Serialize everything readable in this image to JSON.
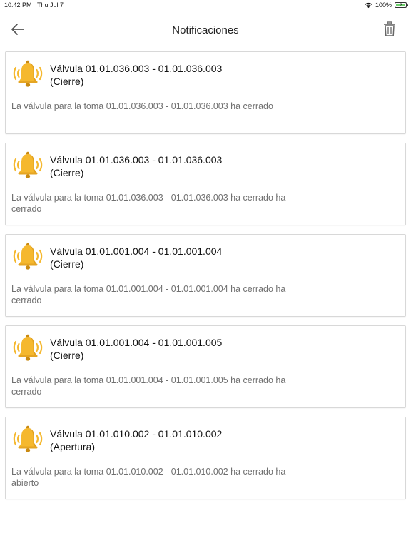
{
  "status": {
    "time": "10:42 PM",
    "date": "Thu Jul 7",
    "battery": "100%"
  },
  "header": {
    "title": "Notificaciones"
  },
  "colors": {
    "bell": "#f5b82e",
    "bell_dark": "#c98a12",
    "text_secondary": "#707070"
  },
  "icons": {
    "back": "arrow-left-icon",
    "trash": "trash-icon",
    "bell": "bell-ringing-icon"
  },
  "notifications": [
    {
      "title": "Válvula 01.01.036.003 - 01.01.036.003",
      "subtitle": "(Cierre)",
      "body": "La válvula para la toma 01.01.036.003 - 01.01.036.003 ha cerrado"
    },
    {
      "title": "Válvula 01.01.036.003 - 01.01.036.003",
      "subtitle": "(Cierre)",
      "body": "La válvula para la toma 01.01.036.003 - 01.01.036.003 ha cerrado ha cerrado"
    },
    {
      "title": "Válvula 01.01.001.004 - 01.01.001.004",
      "subtitle": "(Cierre)",
      "body": "La válvula para la toma 01.01.001.004 - 01.01.001.004 ha cerrado ha cerrado"
    },
    {
      "title": "Válvula 01.01.001.004 - 01.01.001.005",
      "subtitle": "(Cierre)",
      "body": "La válvula para la toma 01.01.001.004 - 01.01.001.005 ha cerrado ha cerrado"
    },
    {
      "title": "Válvula 01.01.010.002 - 01.01.010.002",
      "subtitle": "(Apertura)",
      "body": "La válvula para la toma 01.01.010.002 - 01.01.010.002 ha cerrado ha abierto"
    }
  ]
}
